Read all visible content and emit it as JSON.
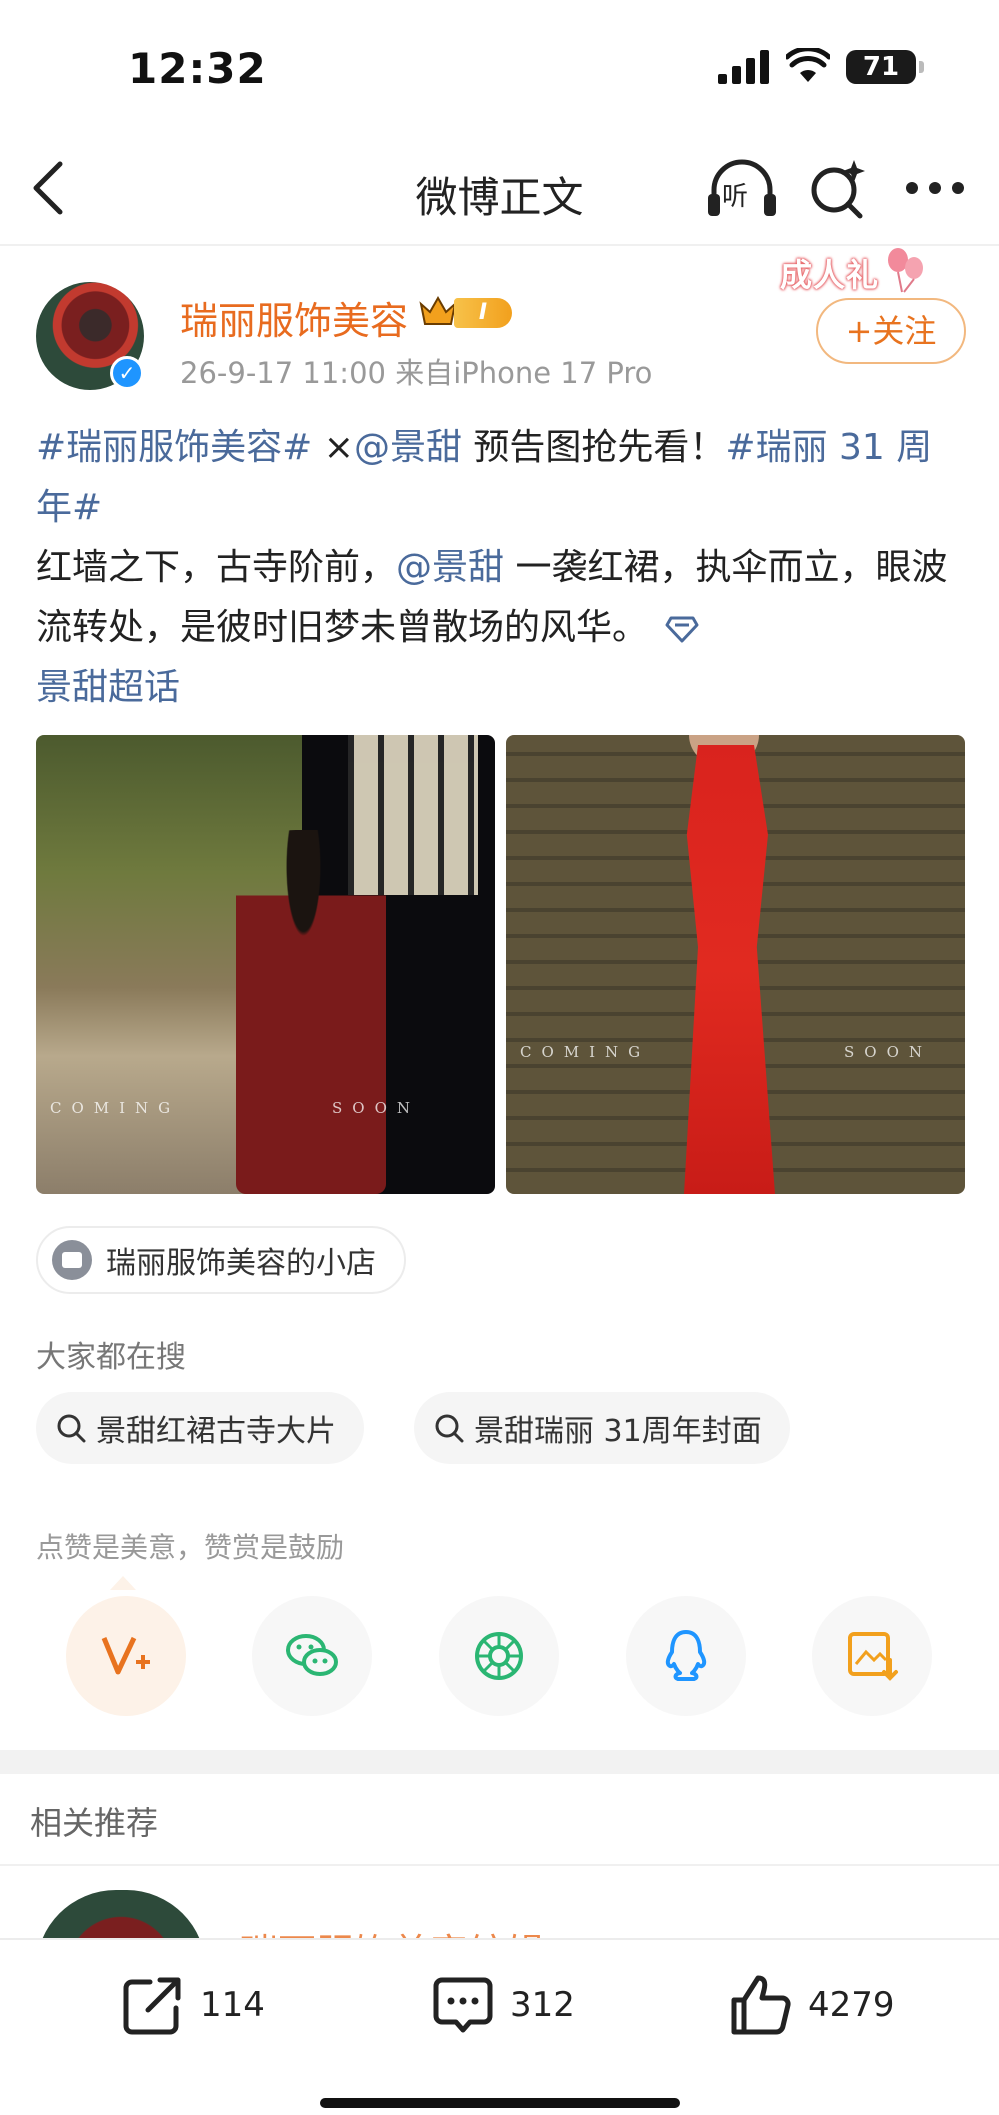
{
  "status": {
    "time": "12:32",
    "battery": "71"
  },
  "nav": {
    "title": "微博正文",
    "listen_label": "听"
  },
  "author": {
    "name": "瑞丽服饰美容",
    "level": "I",
    "meta": "26-9-17 11:00  来自iPhone 17 Pro",
    "badge": "成人礼",
    "follow_label": "+关注"
  },
  "post": {
    "tag1": "#瑞丽服饰美容#",
    "cross": " ×",
    "mention1": "@景甜",
    "text1": " 预告图抢先看！",
    "tag2": "#瑞丽 31 周年#",
    "text2": "红墙之下，古寺阶前，",
    "mention2": "@景甜",
    "text3": " 一袭红裙，执伞而立，眼波流转处，是彼时旧梦未曾散场的风华。",
    "supertopic": "景甜超话"
  },
  "images": [
    {
      "caption_left": "COMING",
      "caption_right": "SOON"
    },
    {
      "caption_left": "COMING",
      "caption_right": "SOON"
    }
  ],
  "shop": {
    "label": "瑞丽服饰美容的小店"
  },
  "hot_search": {
    "title": "大家都在搜",
    "items": [
      "景甜红裙古寺大片",
      "景甜瑞丽 31周年封面"
    ]
  },
  "reward": {
    "note": "点赞是美意，赞赏是鼓励"
  },
  "share": [
    "reward-v-plus-icon",
    "wechat-icon",
    "moments-icon",
    "qq-icon",
    "save-image-icon"
  ],
  "related": {
    "title": "相关推荐",
    "first_name": "瑞丽服饰美容编辑"
  },
  "actions": {
    "reposts": "114",
    "comments": "312",
    "likes": "4279"
  },
  "colors": {
    "accent": "#e8731f",
    "link": "#4a6a9b",
    "muted": "#999999"
  }
}
